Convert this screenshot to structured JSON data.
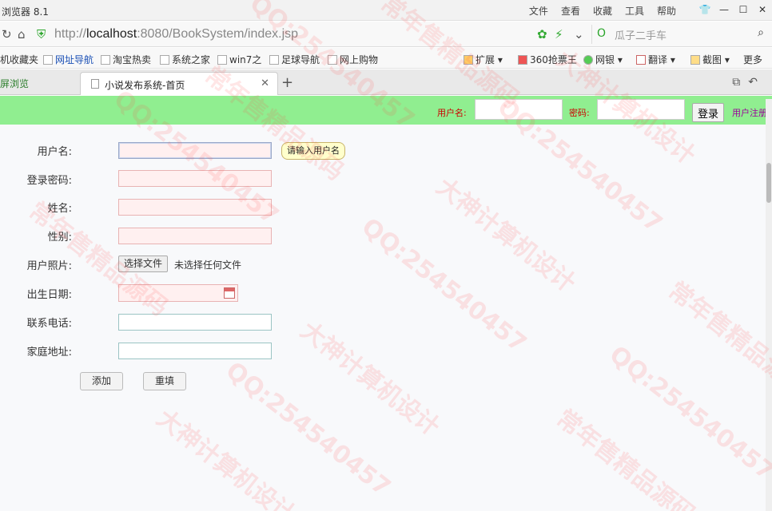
{
  "titlebar": {
    "app_title": "浏览器 8.1",
    "menus": [
      "文件",
      "查看",
      "收藏",
      "工具",
      "帮助"
    ]
  },
  "addressbar": {
    "url_prefix": "http://",
    "url_host": "localhost",
    "url_rest": ":8080/BookSystem/index.jsp",
    "search_text": "瓜子二手车"
  },
  "bookmarks": [
    {
      "label": "机收藏夹"
    },
    {
      "label": "网址导航"
    },
    {
      "label": "淘宝热卖"
    },
    {
      "label": "系统之家"
    },
    {
      "label": "win7之"
    },
    {
      "label": "足球导航"
    },
    {
      "label": "网上购物"
    }
  ],
  "bookmarks_right": [
    "扩展",
    "360抢票王",
    "网银",
    "翻译",
    "截图",
    "更多"
  ],
  "tabbar": {
    "left_tab": "屏浏览",
    "active_tab": "小说发布系统-首页"
  },
  "login_bar": {
    "username_label": "用户名:",
    "password_label": "密码:",
    "login_button": "登录",
    "register_link": "用户注册"
  },
  "form": {
    "username_label": "用户名:",
    "password_label": "登录密码:",
    "name_label": "姓名:",
    "gender_label": "性别:",
    "photo_label": "用户照片:",
    "file_button": "选择文件",
    "file_status": "未选择任何文件",
    "birth_label": "出生日期:",
    "phone_label": "联系电话:",
    "address_label": "家庭地址:",
    "tooltip": "请输入用户名",
    "add_button": "添加",
    "reset_button": "重填"
  },
  "watermark": [
    "QQ:254540457",
    "大神计算机设计",
    "常年售精品源码"
  ]
}
